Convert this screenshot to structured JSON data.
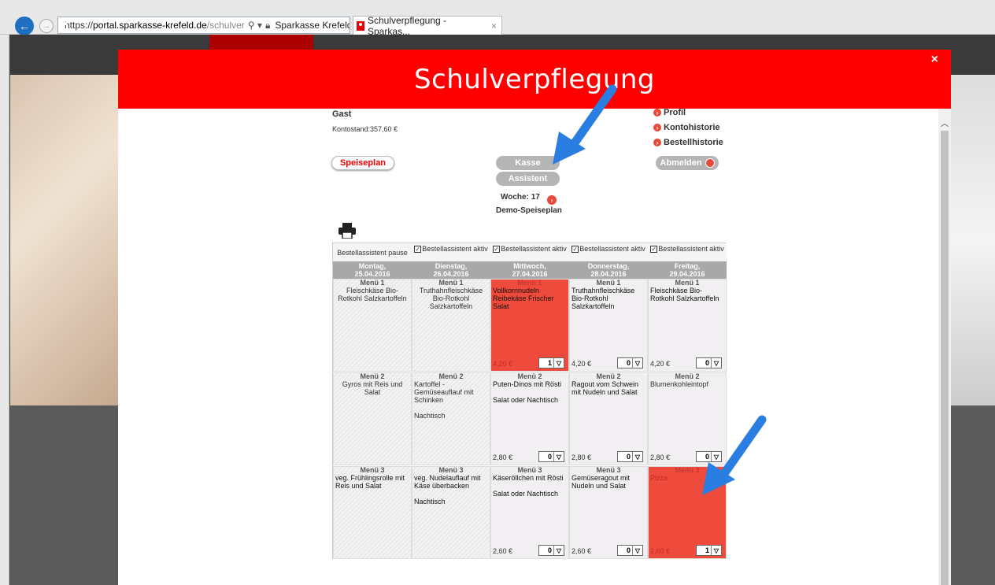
{
  "browser": {
    "url_prefix": "https://",
    "url_host": "portal.sparkasse-krefeld.de",
    "url_path": "/schulver",
    "site_name": "Sparkasse Krefeld...",
    "tab_title": "Schulverpflegung - Sparkas...",
    "tab_close": "×"
  },
  "modal": {
    "title": "Schulverpflegung",
    "close": "×"
  },
  "account": {
    "user": "Gast",
    "balance": "Kontostand:357,60 €"
  },
  "links": [
    "Profil",
    "Kontohistorie",
    "Bestellhistorie"
  ],
  "buttons": {
    "speiseplan": "Speiseplan",
    "kasse": "Kasse",
    "assistent": "Assistent",
    "abmelden": "Abmelden"
  },
  "week": "Woche: 17",
  "plan_name": "Demo-Speiseplan",
  "days": [
    {
      "status": "Bestellassistent pause",
      "checked": false,
      "name": "Montag,",
      "date": "25.04.2016",
      "menus": [
        {
          "header": "Menü 1",
          "text": "Fleischkäse Bio-Rotkohl Salzkartoffeln",
          "style": "stripe",
          "centered": true
        },
        {
          "header": "Menü 2",
          "text": "Gyros mit Reis und Salat",
          "style": "stripe",
          "centered": true
        },
        {
          "header": "Menü 3",
          "text": "veg. Frühlingsrolle mit Reis und Salat",
          "style": "stripe",
          "centered": false,
          "dark": true
        }
      ]
    },
    {
      "status": "Bestellassistent aktiv",
      "checked": true,
      "name": "Dienstag,",
      "date": "26.04.2016",
      "menus": [
        {
          "header": "Menü 1",
          "text": "Truthahnfleischkäse Bio-Rotkohl Salzkartoffeln",
          "style": "stripe",
          "centered": true
        },
        {
          "header": "Menü 2",
          "text": "Kartoffel - Gemüseauflauf mit Schinken",
          "note": "Nachtisch",
          "style": "stripe",
          "centered": false
        },
        {
          "header": "Menü 3",
          "text": "veg. Nudelauflauf mit Käse überbacken",
          "note": " Nachtisch",
          "style": "stripe",
          "centered": false,
          "dark": true
        }
      ]
    },
    {
      "status": "Bestellassistent aktiv",
      "checked": true,
      "name": "Mittwoch,",
      "date": "27.04.2016",
      "menus": [
        {
          "header": "Menü 1",
          "text": "Vollkornnudeln Reibekäse Frischer Salat",
          "price": "4,20 €",
          "qty": "1",
          "style": "sel",
          "centered": false,
          "dark": true
        },
        {
          "header": "Menü 2",
          "text": "Puten-Dinos mit Rösti",
          "note": "Salat oder Nachtisch",
          "price": "2,80 €",
          "qty": "0",
          "style": "normal",
          "centered": false,
          "dark": true
        },
        {
          "header": "Menü 3",
          "text": "Käseröllchen mit Rösti",
          "note": "Salat oder Nachtisch",
          "price": "2,60 €",
          "qty": "0",
          "style": "normal",
          "centered": false,
          "dark": true
        }
      ]
    },
    {
      "status": "Bestellassistent aktiv",
      "checked": true,
      "name": "Donnerstag,",
      "date": "28.04.2016",
      "menus": [
        {
          "header": "Menü 1",
          "text": "Truthahnfleischkäse Bio-Rotkohl Salzkartoffeln",
          "price": "4,20 €",
          "qty": "0",
          "style": "normal",
          "centered": false,
          "dark": true
        },
        {
          "header": "Menü 2",
          "text": "Ragout vom Schwein mit Nudeln und Salat",
          "price": "2,80 €",
          "qty": "0",
          "style": "normal",
          "centered": false,
          "dark": true
        },
        {
          "header": "Menü 3",
          "text": "Gemüseragout mit Nudeln und Salat",
          "price": "2,60 €",
          "qty": "0",
          "style": "normal",
          "centered": false,
          "dark": true
        }
      ]
    },
    {
      "status": "Bestellassistent aktiv",
      "checked": true,
      "name": "Freitag,",
      "date": "29.04.2016",
      "menus": [
        {
          "header": "Menü 1",
          "text": "Fleischkäse Bio-Rotkohl Salzkartoffeln",
          "price": "4,20 €",
          "qty": "0",
          "style": "normal",
          "centered": false,
          "dark": true
        },
        {
          "header": "Menü 2",
          "text": "Blumenkohleintopf",
          "price": "2,80 €",
          "qty": "0",
          "style": "normal",
          "centered": false
        },
        {
          "header": "Menü 3",
          "text": "Pizza",
          "price": "2,60 €",
          "qty": "1",
          "style": "sel",
          "centered": false
        }
      ]
    }
  ],
  "colors": {
    "brand_red": "#ff0000",
    "selected_cell": "#ef4b3c",
    "annotation_arrow": "#2a7de1"
  }
}
